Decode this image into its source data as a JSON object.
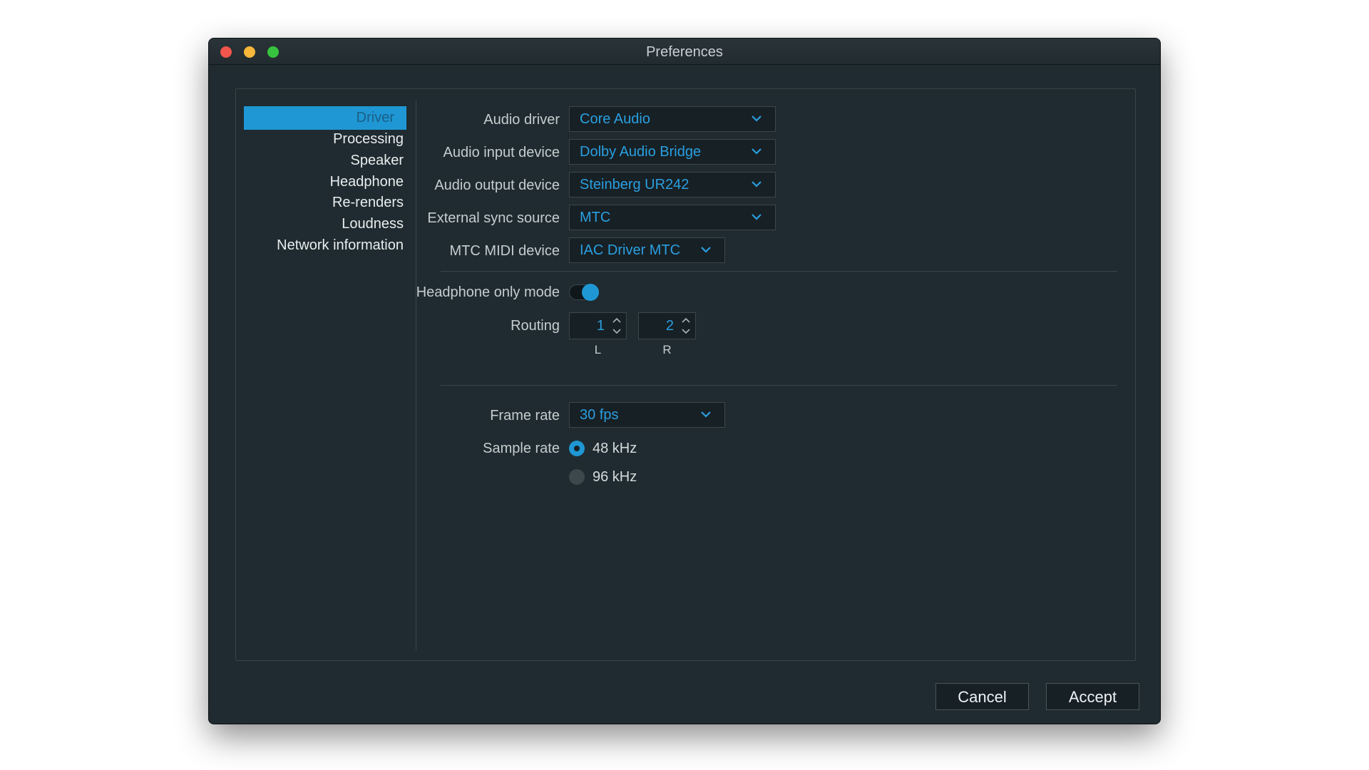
{
  "window": {
    "title": "Preferences"
  },
  "sidebar": {
    "items": [
      {
        "label": "Driver",
        "active": true
      },
      {
        "label": "Processing"
      },
      {
        "label": "Speaker"
      },
      {
        "label": "Headphone"
      },
      {
        "label": "Re-renders"
      },
      {
        "label": "Loudness"
      },
      {
        "label": "Network information"
      }
    ]
  },
  "driver": {
    "audio_driver": {
      "label": "Audio driver",
      "value": "Core Audio"
    },
    "audio_input": {
      "label": "Audio input device",
      "value": "Dolby Audio Bridge"
    },
    "audio_output": {
      "label": "Audio output device",
      "value": "Steinberg UR242"
    },
    "sync_source": {
      "label": "External sync source",
      "value": "MTC"
    },
    "mtc_midi": {
      "label": "MTC MIDI device",
      "value": "IAC Driver MTC"
    }
  },
  "headphone": {
    "label": "Headphone only mode",
    "enabled": true
  },
  "routing": {
    "label": "Routing",
    "left": {
      "value": "1",
      "caption": "L"
    },
    "right": {
      "value": "2",
      "caption": "R"
    }
  },
  "frame_rate": {
    "label": "Frame rate",
    "value": "30 fps"
  },
  "sample_rate": {
    "label": "Sample rate",
    "options": [
      {
        "label": "48 kHz",
        "selected": true
      },
      {
        "label": "96 kHz",
        "selected": false
      }
    ]
  },
  "footer": {
    "cancel_label": "Cancel",
    "accept_label": "Accept"
  },
  "colors": {
    "accent": "#1f97d4",
    "background": "#1f2b30",
    "field": "#172025"
  },
  "icons": {
    "dropdown": "chevron-down-icon",
    "stepper": "up-down-arrows-icon"
  }
}
